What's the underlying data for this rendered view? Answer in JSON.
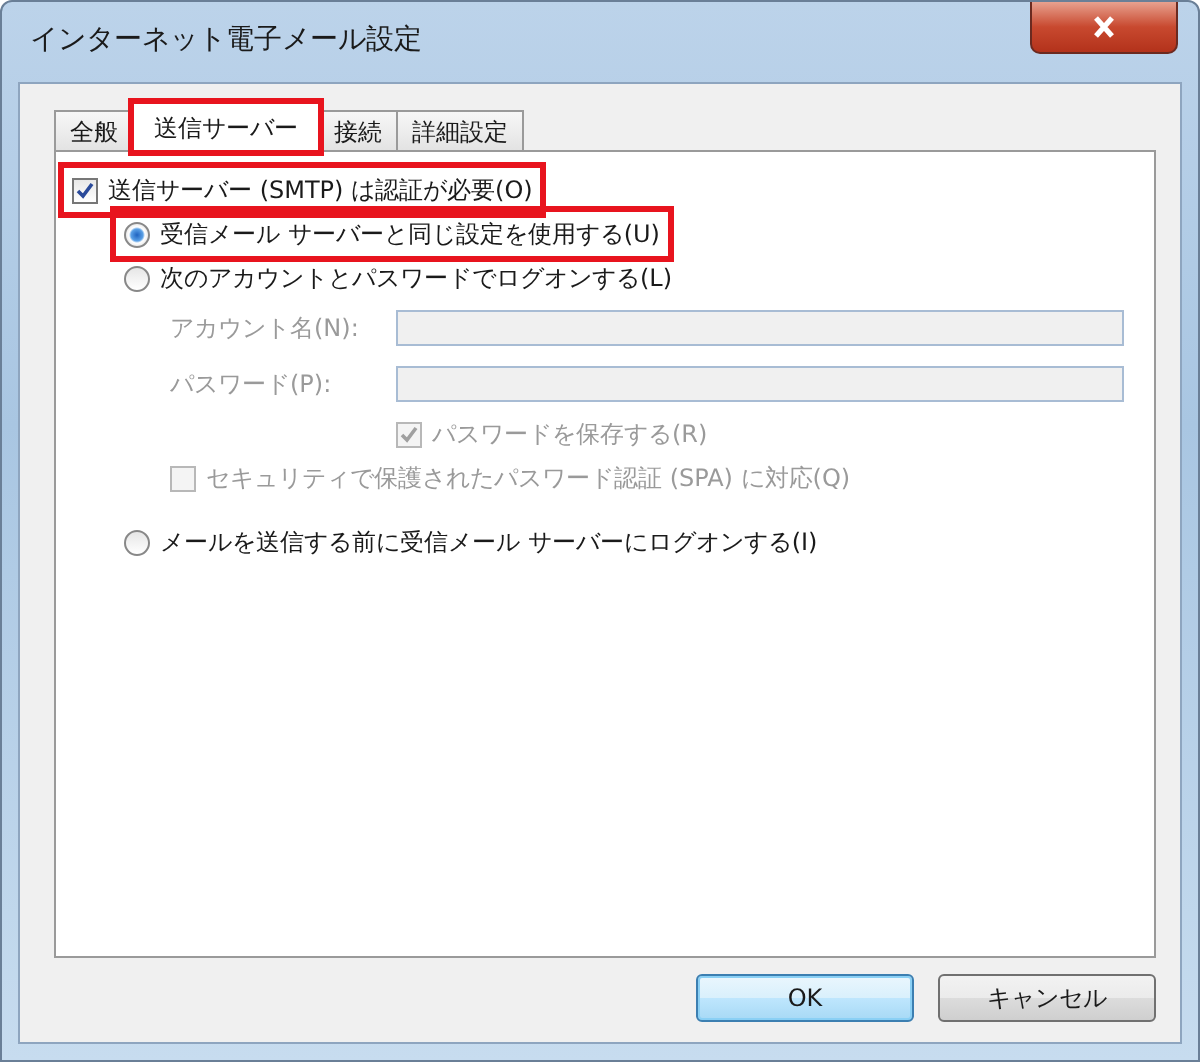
{
  "window": {
    "title": "インターネット電子メール設定"
  },
  "tabs": [
    {
      "label": "全般",
      "selected": false,
      "highlighted": false
    },
    {
      "label": "送信サーバー",
      "selected": true,
      "highlighted": true
    },
    {
      "label": "接続",
      "selected": false,
      "highlighted": false
    },
    {
      "label": "詳細設定",
      "selected": false,
      "highlighted": false
    }
  ],
  "smtp_auth": {
    "label": "送信サーバー (SMTP) は認証が必要(O)",
    "checked": true,
    "highlighted": true,
    "children": [
      {
        "kind": "radio",
        "label": "受信メール サーバーと同じ設定を使用する(U)",
        "selected": true,
        "disabled": false,
        "highlighted": true
      },
      {
        "kind": "radio",
        "label": "次のアカウントとパスワードでログオンする(L)",
        "selected": false,
        "disabled": false,
        "highlighted": false,
        "children": [
          {
            "kind": "field",
            "label": "アカウント名(N):",
            "disabled": true
          },
          {
            "kind": "field",
            "label": "パスワード(P):",
            "disabled": true
          },
          {
            "kind": "field-checkbox",
            "label": "パスワードを保存する(R)",
            "checked": true,
            "disabled": true
          },
          {
            "kind": "checkbox",
            "label": "セキュリティで保護されたパスワード認証 (SPA) に対応(Q)",
            "checked": false,
            "disabled": true
          }
        ]
      },
      {
        "kind": "radio",
        "label": "メールを送信する前に受信メール サーバーにログオンする(I)",
        "selected": false,
        "disabled": false,
        "highlighted": false
      }
    ]
  },
  "buttons": [
    {
      "label": "OK",
      "default": true
    },
    {
      "label": "キャンセル",
      "default": false
    }
  ]
}
